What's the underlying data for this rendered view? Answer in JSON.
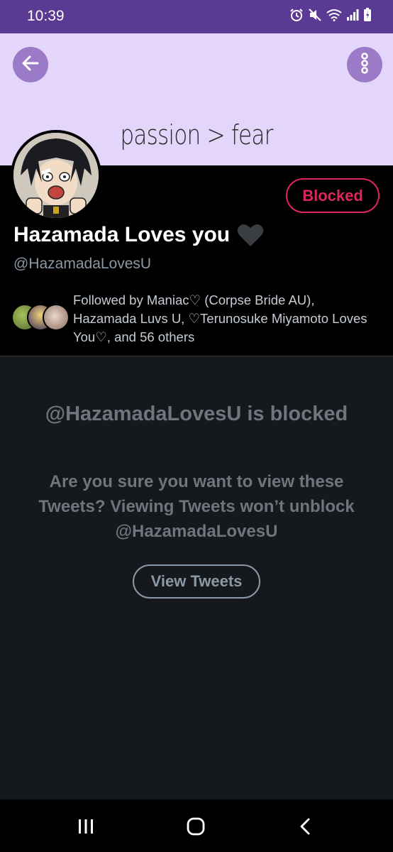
{
  "status_bar": {
    "time": "10:39",
    "icons": [
      "alarm-icon",
      "mute-icon",
      "wifi-icon",
      "signal-icon",
      "battery-icon"
    ],
    "background": "#5b3a94"
  },
  "header": {
    "banner_text": "passion > fear",
    "banner_color": "#e4d6fb",
    "back_icon": "arrow-left-icon",
    "more_icon": "more-vertical-icon"
  },
  "profile": {
    "display_name": "Hazamada Loves you",
    "name_emoji": "black-heart-icon",
    "handle": "@HazamadaLovesU",
    "blocked_label": "Blocked",
    "followed_by": "Followed by Maniac♡ (Corpse Bride AU), Hazamada Luvs U, ♡Terunosuke Miyamoto Loves You♡, and 56 others",
    "accent": "#e0245e"
  },
  "blocked_notice": {
    "title": "@HazamadaLovesU is blocked",
    "description": "Are you sure you want to view these Tweets? Viewing Tweets won’t unblock @HazamadaLovesU",
    "view_button": "View Tweets"
  },
  "nav_bar": {
    "icons": [
      "recent-apps-icon",
      "home-icon",
      "back-icon"
    ]
  }
}
